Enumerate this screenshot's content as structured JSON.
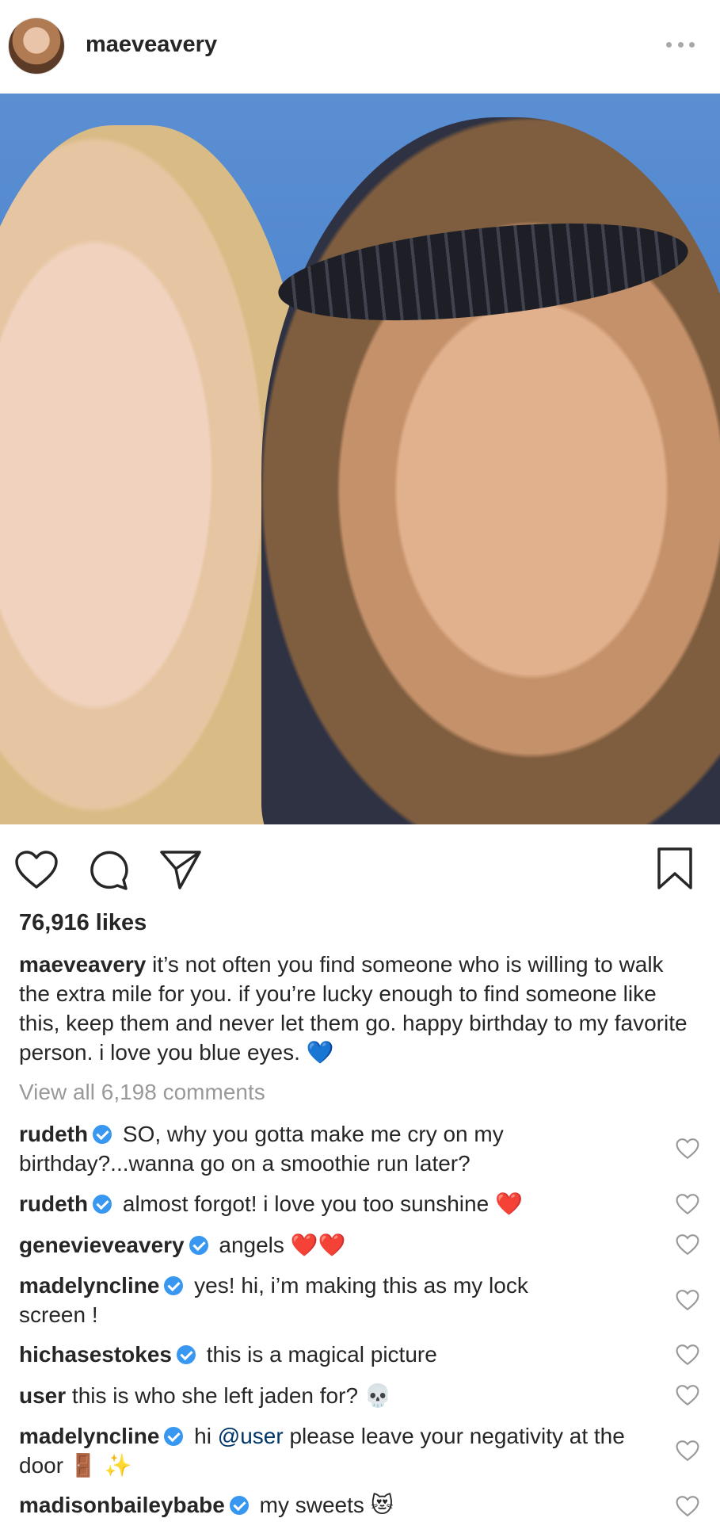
{
  "header": {
    "username": "maeveavery"
  },
  "post": {
    "likes": "76,916 likes",
    "caption_user": "maeveavery",
    "caption_text": " it’s not often you find someone who is willing to walk the extra mile for you. if you’re lucky enough to find someone like this, keep them and never let them go. happy birthday to my favorite person. i love you blue eyes. ",
    "caption_emoji": "💙",
    "view_all": "View all 6,198 comments"
  },
  "comments": [
    {
      "user": "rudeth",
      "text": " SO, why you gotta make me cry on my birthday?...wanna go on a smoothie run later?"
    },
    {
      "user": "rudeth",
      "text": " almost forgot! i love you too sunshine ",
      "emoji": "❤️"
    },
    {
      "user": "genevieveavery",
      "text": " angels ",
      "emoji": "❤️❤️"
    },
    {
      "user": "madelyncline",
      "text": " yes! hi, i’m making this as my lock screen !"
    },
    {
      "user": "hichasestokes",
      "text": " this is a magical picture"
    },
    {
      "user": "user",
      "text": " this is who she left jaden for? ",
      "emoji": "💀"
    },
    {
      "user": "madelyncline",
      "text_before": " hi ",
      "mention": "@user",
      "text_after": " please leave your negativity at the door ",
      "emoji": "🚪 ✨"
    },
    {
      "user": "madisonbaileybabe",
      "text": " my sweets ",
      "emoji": "😻"
    }
  ],
  "colors": {
    "verified": "#3897f0",
    "muted": "#999999",
    "mention": "#003569"
  },
  "icons": [
    "more-options-icon",
    "heart-icon",
    "comment-icon",
    "share-icon",
    "bookmark-icon",
    "verified-badge-icon"
  ]
}
